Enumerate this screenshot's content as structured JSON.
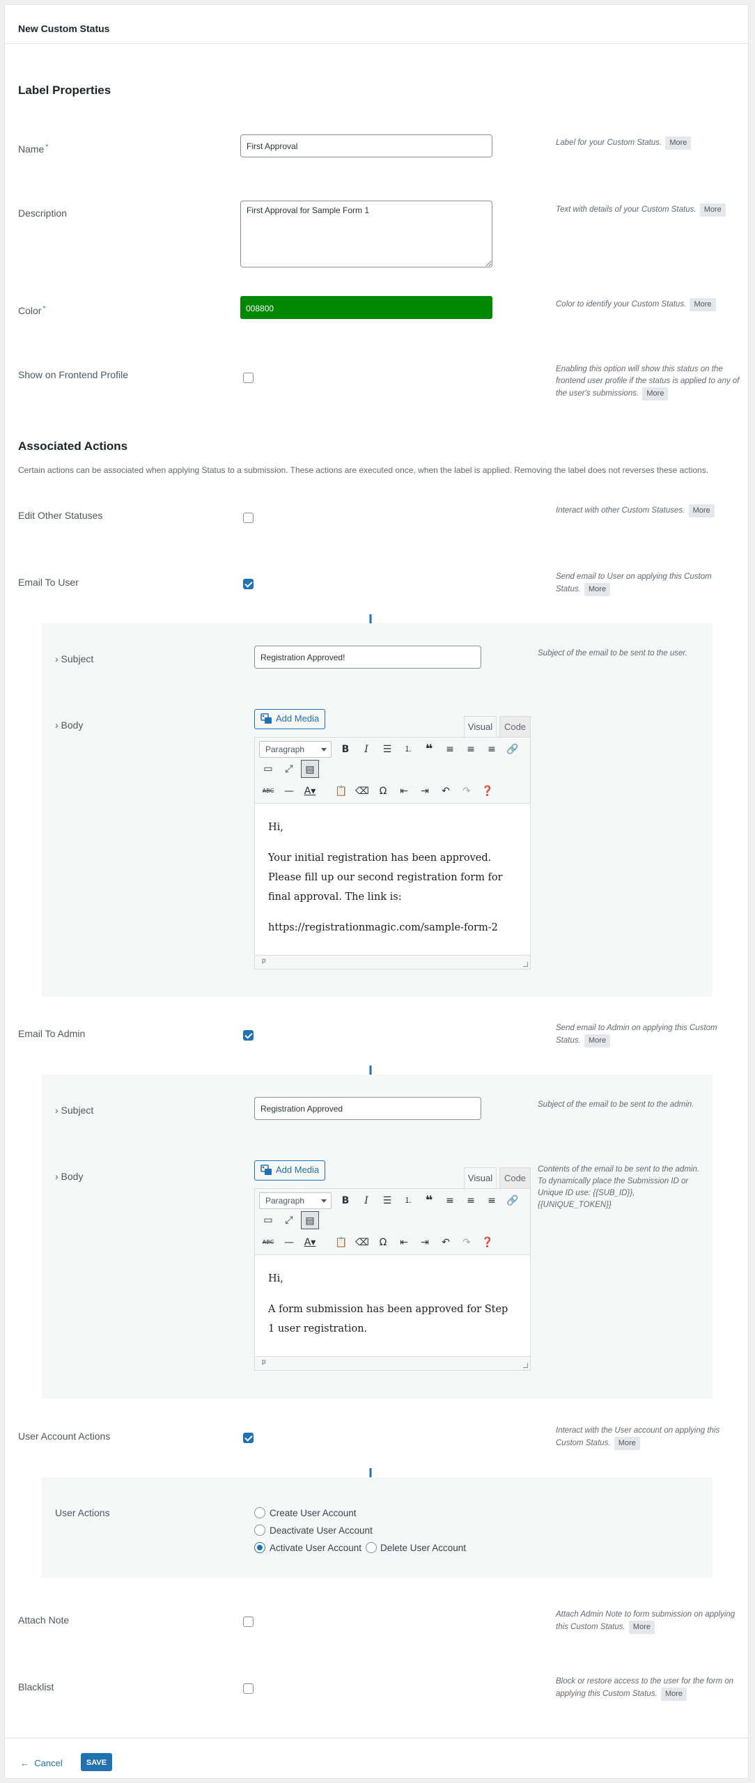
{
  "page": {
    "title": "New Custom Status"
  },
  "label_properties": {
    "heading": "Label Properties",
    "name": {
      "label": "Name",
      "required_mark": "*",
      "value": "First Approval",
      "help": "Label for your Custom Status.",
      "more": "More"
    },
    "description": {
      "label": "Description",
      "value": "First Approval for Sample Form 1",
      "help": "Text with details of your Custom Status.",
      "more": "More"
    },
    "color": {
      "label": "Color",
      "required_mark": "*",
      "value": "008800",
      "hex": "#008800",
      "help": "Color to identify your Custom Status.",
      "more": "More"
    },
    "frontend": {
      "label": "Show on Frontend Profile",
      "checked": false,
      "help": "Enabling this option will show this status on the frontend user profile if the status is applied to any of the user's submissions.",
      "more": "More"
    }
  },
  "associated_actions": {
    "heading": "Associated Actions",
    "description": "Certain actions can be associated when applying Status to a submission. These actions are executed once, when the label is applied. Removing the label does not reverses these actions.",
    "edit_other": {
      "label": "Edit Other Statuses",
      "checked": false,
      "help": "Interact with other Custom Statuses.",
      "more": "More"
    },
    "email_user": {
      "label": "Email To User",
      "checked": true,
      "help": "Send email to User on applying this Custom Status.",
      "more": "More",
      "subject_label": "› Subject",
      "subject_value": "Registration Approved!",
      "subject_help": "Subject of the email to be sent to the user.",
      "body_label": "› Body",
      "body_paragraphs": [
        "Hi,",
        "Your initial registration has been approved. Please fill up our second registration form for final approval. The link is:",
        "https://registrationmagic.com/sample-form-2"
      ],
      "status_path": "p"
    },
    "email_admin": {
      "label": "Email To Admin",
      "checked": true,
      "help": "Send email to Admin on applying this Custom Status.",
      "more": "More",
      "subject_label": "› Subject",
      "subject_value": "Registration Approved",
      "subject_help": "Subject of the email to be sent to the admin.",
      "body_label": "› Body",
      "body_help": "Contents of the email to be sent to the admin. To dynamically place the Submission ID or Unique ID use: {{SUB_ID}},{{UNIQUE_TOKEN}}",
      "body_paragraphs": [
        "Hi,",
        "A form submission has been approved for Step 1 user registration."
      ],
      "status_path": "p"
    },
    "user_account": {
      "label": "User Account Actions",
      "checked": true,
      "help": "Interact with the User account on applying this Custom Status.",
      "more": "More",
      "user_actions_label": "User Actions",
      "options": [
        {
          "label": "Create User Account",
          "selected": false
        },
        {
          "label": "Deactivate User Account",
          "selected": false
        },
        {
          "label": "Activate User Account",
          "selected": true
        },
        {
          "label": "Delete User Account",
          "selected": false
        }
      ]
    },
    "attach_note": {
      "label": "Attach Note",
      "checked": false,
      "help": "Attach Admin Note to form submission on applying this Custom Status.",
      "more": "More"
    },
    "blacklist": {
      "label": "Blacklist",
      "checked": false,
      "help": "Block or restore access to the user for the form on applying this Custom Status.",
      "more": "More"
    }
  },
  "editor": {
    "add_media": "Add Media",
    "tab_visual": "Visual",
    "tab_code": "Code",
    "format_select": "Paragraph",
    "row1_icons": [
      "bold-icon",
      "italic-icon",
      "bullet-list-icon",
      "numbered-list-icon",
      "blockquote-icon",
      "align-left-icon",
      "align-center-icon",
      "align-right-icon",
      "link-icon",
      "read-more-icon",
      "fullscreen-icon",
      "toolbar-toggle-icon"
    ],
    "row2_icons": [
      "strikethrough-icon",
      "horizontal-rule-icon",
      "text-color-icon",
      "paste-text-icon",
      "clear-formatting-icon",
      "special-character-icon",
      "outdent-icon",
      "indent-icon",
      "undo-icon",
      "redo-icon",
      "help-icon"
    ]
  },
  "footer": {
    "cancel": "Cancel",
    "save": "SAVE",
    "accent": "#2271b1"
  }
}
